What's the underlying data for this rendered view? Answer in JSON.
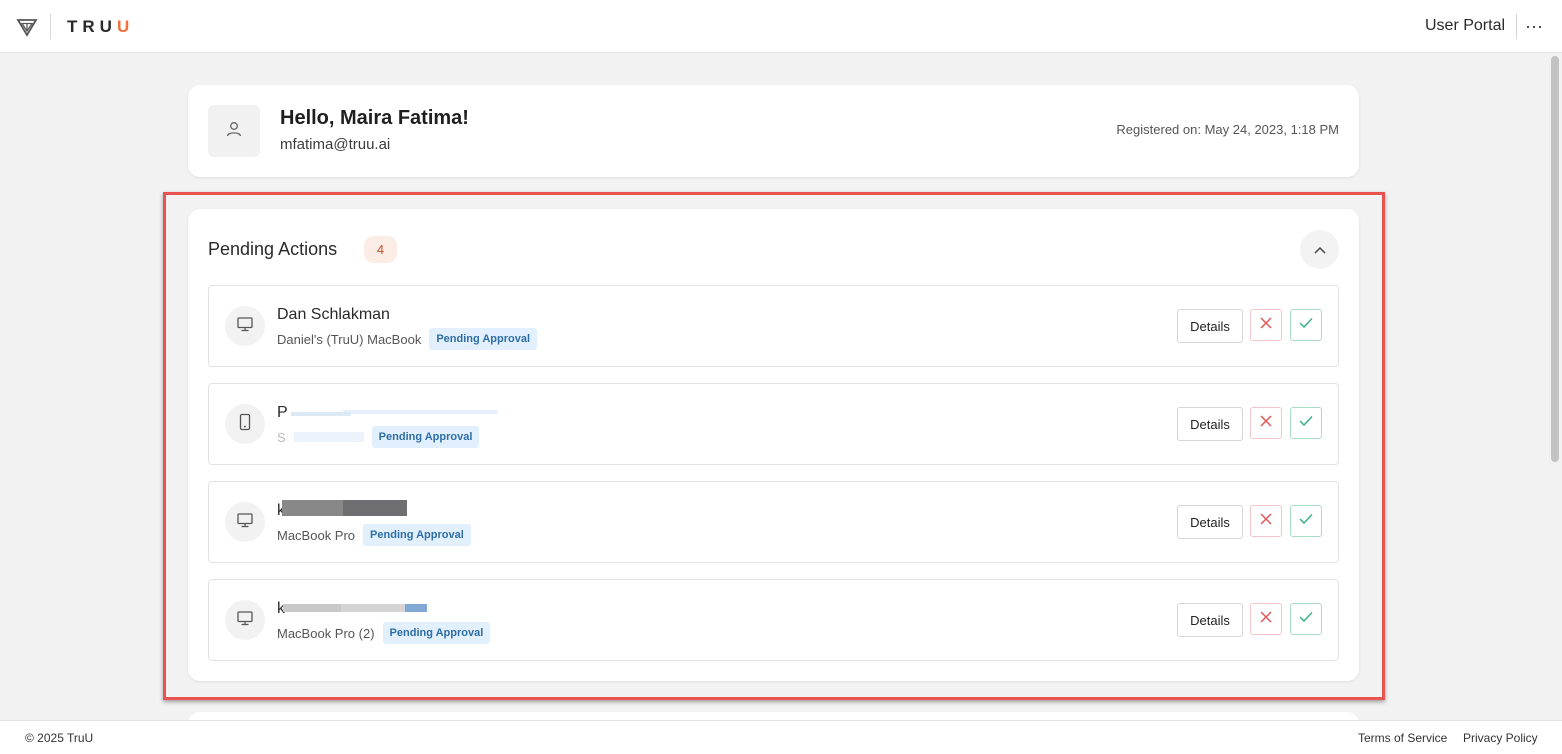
{
  "header": {
    "logo_text_main": "TRU",
    "logo_text_accent": "U",
    "portal_label": "User Portal",
    "more_label": "···"
  },
  "profile": {
    "greeting": "Hello, Maira Fatima!",
    "email": "mfatima@truu.ai",
    "registered": "Registered on: May 24, 2023, 1:18 PM"
  },
  "pending": {
    "title": "Pending Actions",
    "count": "4",
    "rows": [
      {
        "device_type": "desktop",
        "name": "Dan Schlakman",
        "device": "Daniel's (TruU) MacBook",
        "status": "Pending Approval",
        "details_label": "Details"
      },
      {
        "device_type": "phone",
        "name": "P",
        "device": "S",
        "status": "Pending Approval",
        "details_label": "Details"
      },
      {
        "device_type": "desktop",
        "name": "k",
        "device": "MacBook Pro",
        "status": "Pending Approval",
        "details_label": "Details"
      },
      {
        "device_type": "desktop",
        "name": "k",
        "device": "MacBook Pro (2)",
        "status": "Pending Approval",
        "details_label": "Details"
      }
    ]
  },
  "footer": {
    "copyright": "© 2025 TruU",
    "terms": "Terms of Service",
    "privacy": "Privacy Policy"
  },
  "colors": {
    "accent": "#f0703a",
    "highlight": "#e9534f",
    "reject": "#e05555",
    "approve": "#3bb38a",
    "status_badge_bg": "#e2f0fd",
    "status_badge_text": "#2e6ea6"
  }
}
